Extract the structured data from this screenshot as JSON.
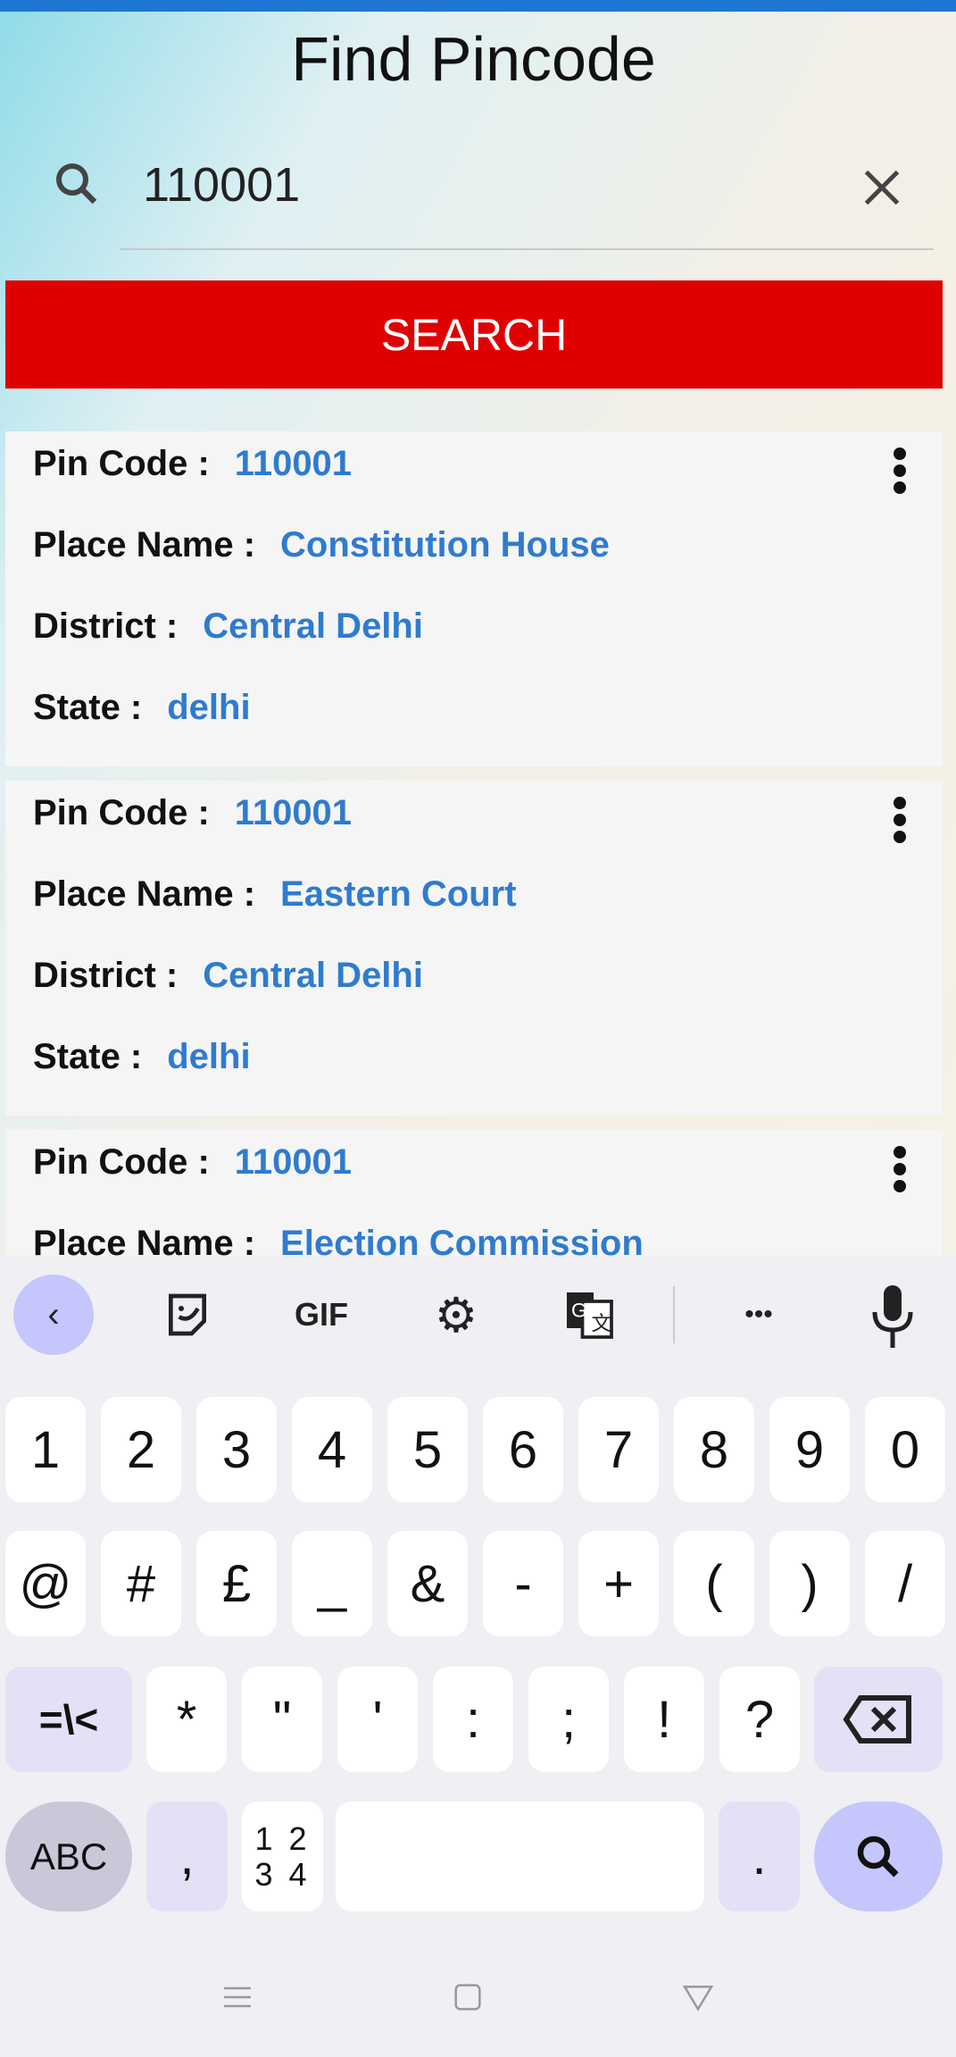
{
  "header": {
    "title": "Find Pincode"
  },
  "search": {
    "value": "110001",
    "button_label": "SEARCH"
  },
  "results": [
    {
      "pin_label": "Pin Code :",
      "pin": "110001",
      "place_label": "Place Name :",
      "place": "Constitution House",
      "district_label": "District :",
      "district": "Central Delhi",
      "state_label": "State :",
      "state": "delhi"
    },
    {
      "pin_label": "Pin Code :",
      "pin": "110001",
      "place_label": "Place Name :",
      "place": "Eastern Court",
      "district_label": "District :",
      "district": "Central Delhi",
      "state_label": "State :",
      "state": "delhi"
    },
    {
      "pin_label": "Pin Code :",
      "pin": "110001",
      "place_label": "Place Name :",
      "place": "Election Commission"
    }
  ],
  "keyboard": {
    "toolbar": {
      "gif": "GIF",
      "more": "•••"
    },
    "row1": [
      "1",
      "2",
      "3",
      "4",
      "5",
      "6",
      "7",
      "8",
      "9",
      "0"
    ],
    "row2": [
      "@",
      "#",
      "£",
      "_",
      "&",
      "-",
      "+",
      "(",
      ")",
      "/"
    ],
    "row3_mod": "=\\<",
    "row3": [
      "*",
      "\"",
      "'",
      ":",
      ";",
      "!",
      "?"
    ],
    "abc": "ABC",
    "comma": ",",
    "numpad": "1 2\n3 4",
    "period": "."
  },
  "colors": {
    "accent": "#df0000",
    "value": "#2f7bcf",
    "status_bar": "#1e76d3"
  }
}
